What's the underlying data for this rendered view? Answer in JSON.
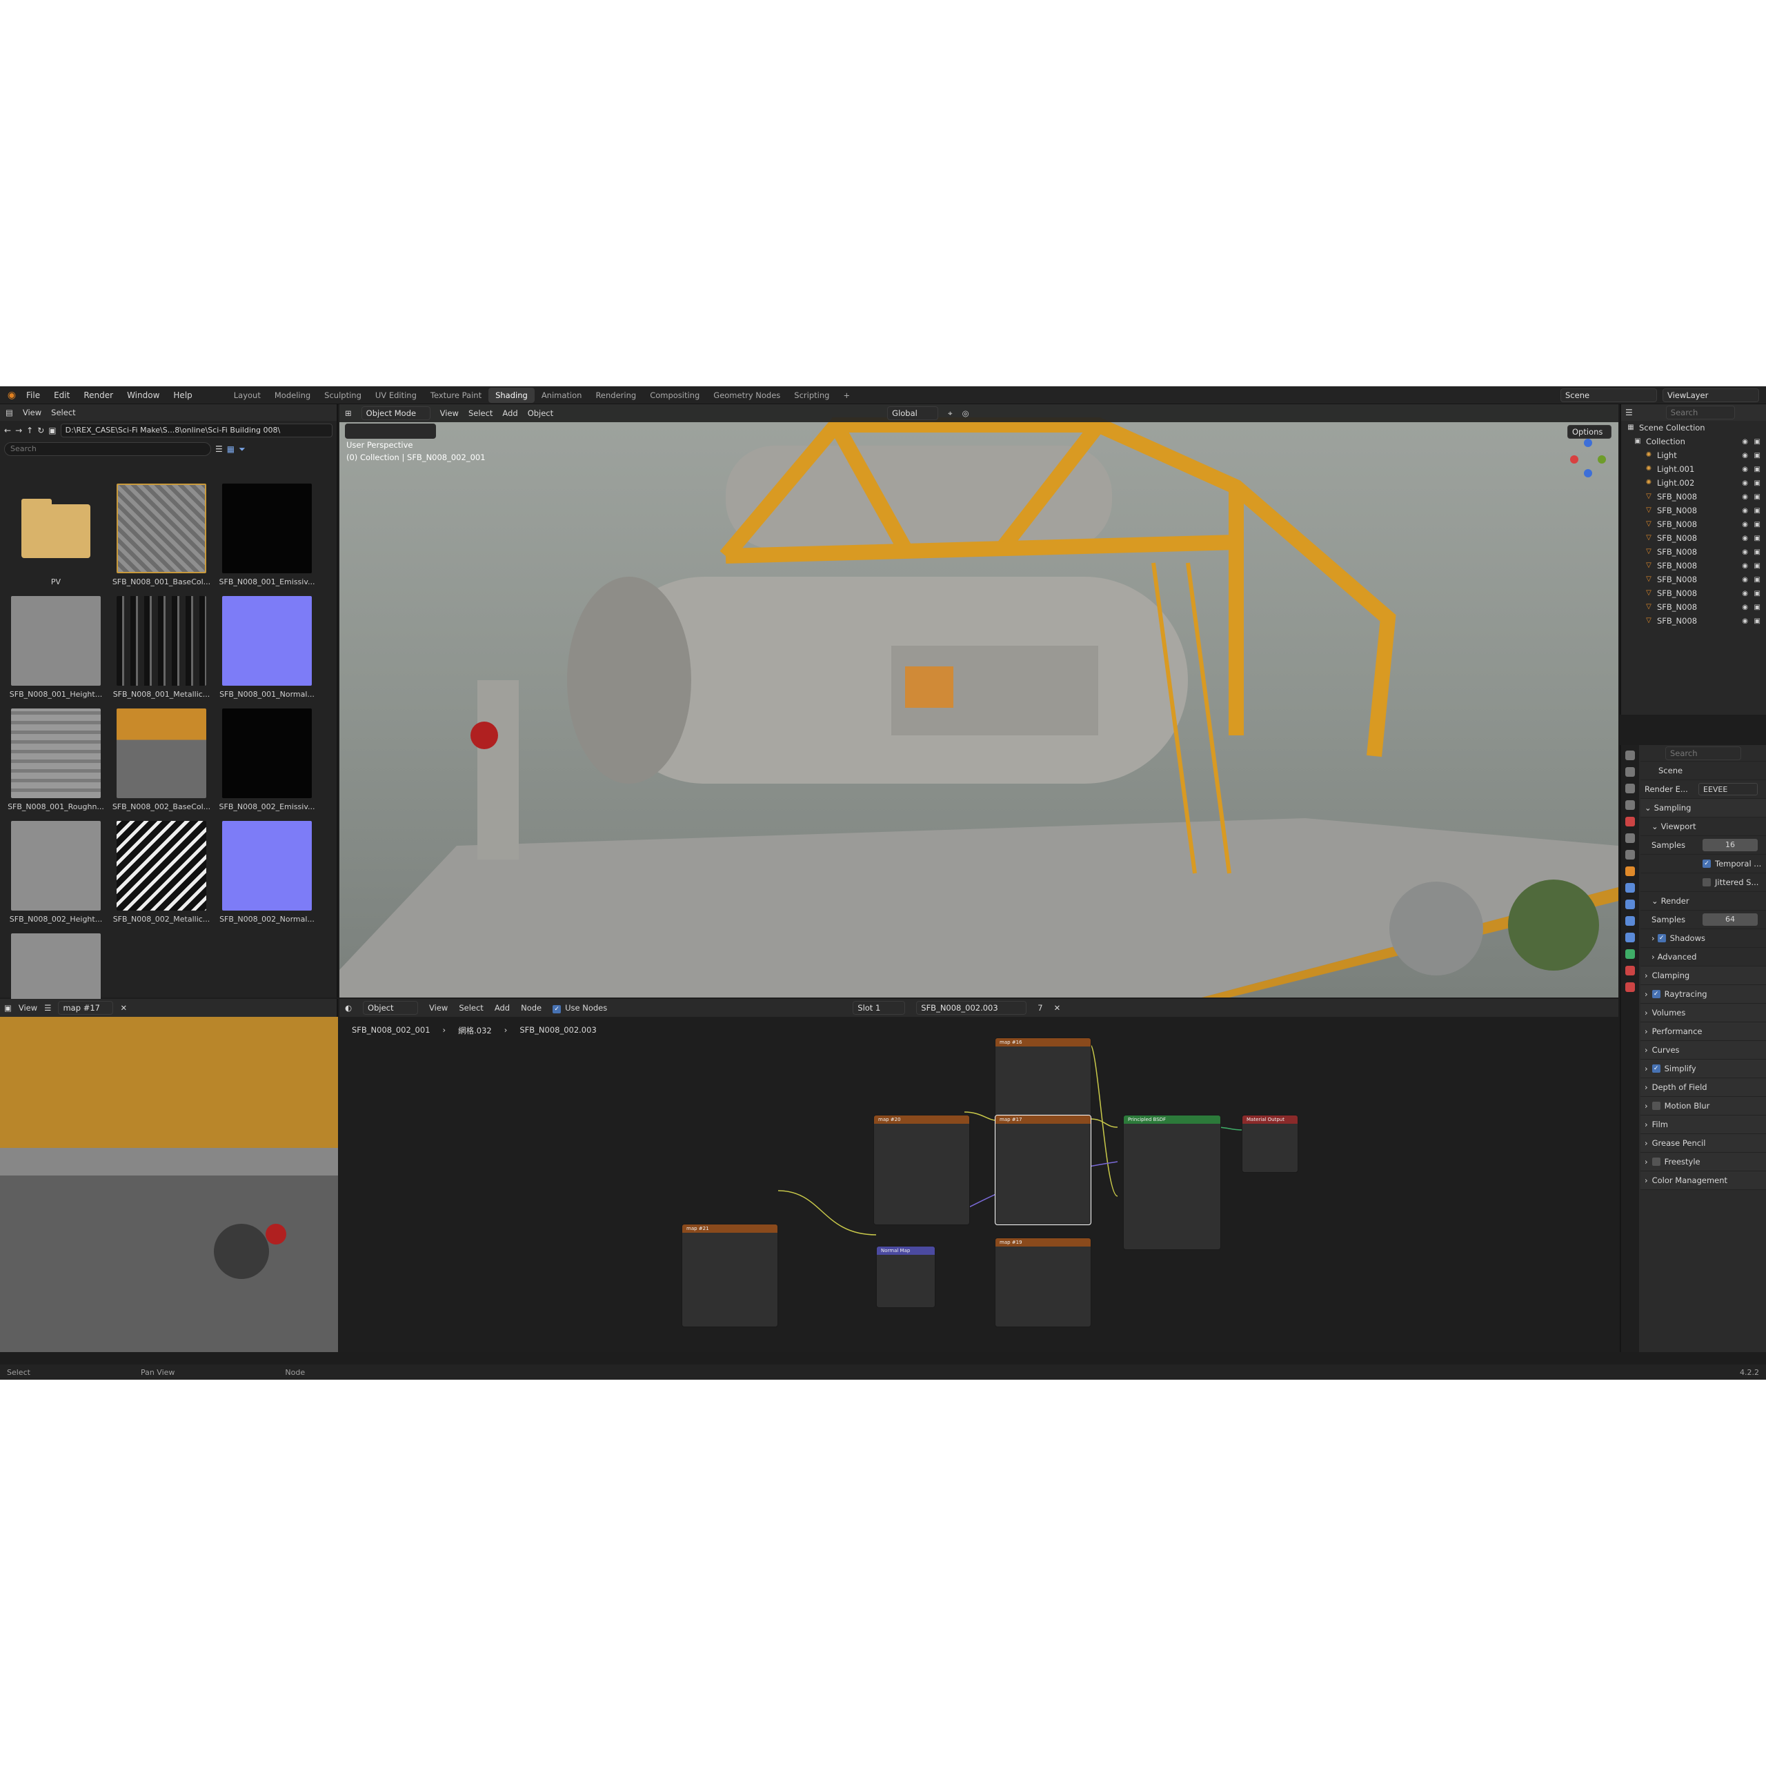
{
  "menu": [
    "File",
    "Edit",
    "Render",
    "Window",
    "Help"
  ],
  "workspaces": [
    "Layout",
    "Modeling",
    "Sculpting",
    "UV Editing",
    "Texture Paint",
    "Shading",
    "Animation",
    "Rendering",
    "Compositing",
    "Geometry Nodes",
    "Scripting"
  ],
  "active_workspace": "Shading",
  "top_right": {
    "scene": "Scene",
    "view_layer": "ViewLayer"
  },
  "file_browser": {
    "header": [
      "View",
      "Select"
    ],
    "path": "D:\\REX_CASE\\Sci-Fi Make\\S...8\\online\\Sci-Fi Building 008\\",
    "search_placeholder": "Search",
    "files": [
      "PV",
      "SFB_N008_001_BaseCol...",
      "SFB_N008_001_Emissiv...",
      "SFB_N008_001_Height...",
      "SFB_N008_001_Metallic...",
      "SFB_N008_001_Normal...",
      "SFB_N008_001_Roughn...",
      "SFB_N008_002_BaseCol...",
      "SFB_N008_002_Emissiv...",
      "SFB_N008_002_Height...",
      "SFB_N008_002_Metallic...",
      "SFB_N008_002_Normal..."
    ]
  },
  "viewport": {
    "mode": "Object Mode",
    "menu": [
      "View",
      "Select",
      "Add",
      "Object"
    ],
    "transform": "Global",
    "options": "Options",
    "perspective": "User Perspective",
    "collection_info": "(0) Collection | SFB_N008_002_001"
  },
  "outliner": {
    "search_placeholder": "Search",
    "rows": [
      {
        "label": "Scene Collection",
        "type": "scene"
      },
      {
        "label": "Collection",
        "type": "collection"
      },
      {
        "label": "Light",
        "type": "light"
      },
      {
        "label": "Light.001",
        "type": "light"
      },
      {
        "label": "Light.002",
        "type": "light"
      },
      {
        "label": "SFB_N008",
        "type": "mesh"
      },
      {
        "label": "SFB_N008",
        "type": "mesh"
      },
      {
        "label": "SFB_N008",
        "type": "mesh"
      },
      {
        "label": "SFB_N008",
        "type": "mesh"
      },
      {
        "label": "SFB_N008",
        "type": "mesh"
      },
      {
        "label": "SFB_N008",
        "type": "mesh"
      },
      {
        "label": "SFB_N008",
        "type": "mesh"
      },
      {
        "label": "SFB_N008",
        "type": "mesh"
      },
      {
        "label": "SFB_N008",
        "type": "mesh"
      },
      {
        "label": "SFB_N008",
        "type": "mesh"
      }
    ]
  },
  "properties": {
    "search_placeholder": "Search",
    "context": "Scene",
    "render_engine_label": "Render E...",
    "render_engine": "EEVEE",
    "sampling": "Sampling",
    "viewport": "Viewport",
    "samples_label": "Samples",
    "viewport_samples": "16",
    "temporal": "Temporal ...",
    "jittered": "Jittered S...",
    "render": "Render",
    "render_samples": "64",
    "shadows": "Shadows",
    "advanced": "Advanced",
    "sections": [
      "Clamping",
      "Raytracing",
      "Volumes",
      "Performance",
      "Curves",
      "Simplify",
      "Depth of Field",
      "Motion Blur",
      "Film",
      "Grease Pencil",
      "Freestyle",
      "Color Management"
    ]
  },
  "image_editor": {
    "view": "View",
    "image": "map #17"
  },
  "node_editor": {
    "object": "Object",
    "menu": [
      "View",
      "Select",
      "Add",
      "Node"
    ],
    "use_nodes": "Use Nodes",
    "slot": "Slot 1",
    "material": "SFB_N008_002.003",
    "users": "7",
    "breadcrumb": [
      "SFB_N008_002_001",
      "網格.032",
      "SFB_N008_002.003"
    ],
    "nodes": {
      "map16": "map #16",
      "map20": "map #20",
      "map17": "map #17",
      "map21": "map #21",
      "map19": "map #19",
      "normal_map": "Normal Map",
      "bsdf": "Principled BSDF",
      "output": "Material Output"
    }
  },
  "status": {
    "left": "Select",
    "mid": "Pan View",
    "right": "Node",
    "version": "4.2.2"
  }
}
